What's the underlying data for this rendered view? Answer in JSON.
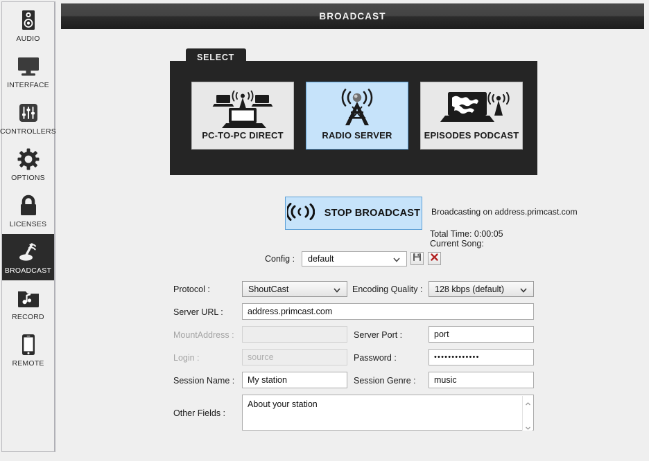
{
  "header": {
    "title": "BROADCAST"
  },
  "sidebar": {
    "items": [
      {
        "label": "AUDIO",
        "icon": "speaker-icon",
        "active": false
      },
      {
        "label": "INTERFACE",
        "icon": "monitor-icon",
        "active": false
      },
      {
        "label": "CONTROLLERS",
        "icon": "sliders-icon",
        "active": false
      },
      {
        "label": "OPTIONS",
        "icon": "gear-icon",
        "active": false
      },
      {
        "label": "LICENSES",
        "icon": "lock-icon",
        "active": false
      },
      {
        "label": "BROADCAST",
        "icon": "broadcast-icon",
        "active": true
      },
      {
        "label": "RECORD",
        "icon": "music-folder-icon",
        "active": false
      },
      {
        "label": "REMOTE",
        "icon": "phone-icon",
        "active": false
      }
    ]
  },
  "select_panel": {
    "tab_label": "SELECT",
    "modes": [
      {
        "label": "PC-TO-PC DIRECT",
        "icon": "two-laptops-antenna-icon",
        "selected": false
      },
      {
        "label": "RADIO SERVER",
        "icon": "radio-tower-icon",
        "selected": true
      },
      {
        "label": "EPISODES PODCAST",
        "icon": "laptop-world-antenna-icon",
        "selected": false
      }
    ]
  },
  "broadcast": {
    "button_label": "STOP BROADCAST",
    "button_icon": "broadcast-wave-icon",
    "status": "Broadcasting on address.primcast.com",
    "total_time": "Total Time: 0:00:05",
    "current_song": "Current Song:"
  },
  "config": {
    "label": "Config :",
    "value": "default",
    "save_icon": "floppy-save-icon",
    "delete_icon": "red-x-delete-icon"
  },
  "form": {
    "protocol": {
      "label": "Protocol :",
      "value": "ShoutCast"
    },
    "encoding_quality": {
      "label": "Encoding Quality :",
      "value": "128 kbps (default)"
    },
    "server_url": {
      "label": "Server URL :",
      "value": "address.primcast.com"
    },
    "mount_address": {
      "label": "MountAddress :",
      "value": "",
      "disabled": true
    },
    "server_port": {
      "label": "Server Port :",
      "value": "port"
    },
    "login": {
      "label": "Login :",
      "value": "source",
      "disabled": true
    },
    "password": {
      "label": "Password :",
      "value": "•••••••••••••"
    },
    "session_name": {
      "label": "Session Name :",
      "value": "My station"
    },
    "session_genre": {
      "label": "Session Genre :",
      "value": "music"
    },
    "other_fields": {
      "label": "Other Fields :",
      "value": "About your station"
    }
  },
  "colors": {
    "accent_selected": "#c6e3fa",
    "accent_border": "#5b9fd6",
    "panel_dark": "#252525",
    "page_bg": "#efefef"
  }
}
